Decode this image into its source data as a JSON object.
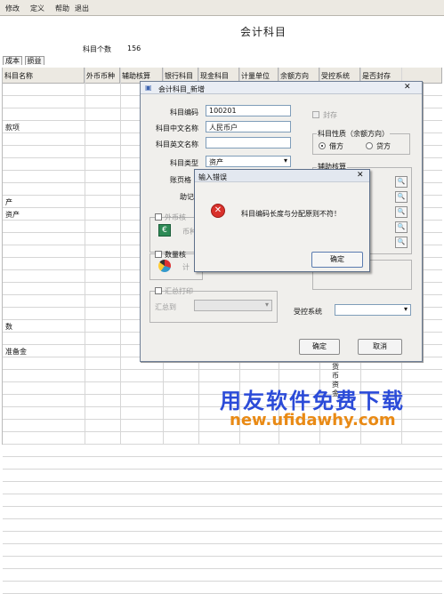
{
  "menu": [
    "修改",
    "定义",
    "帮助",
    "退出"
  ],
  "main": {
    "title": "会计科目",
    "count_label": "科目个数",
    "count_value": "156",
    "tabs": [
      "成本",
      "损益"
    ],
    "headers": [
      "科目名称",
      "外币币种",
      "辅助核算",
      "银行科目",
      "现金科目",
      "计量单位",
      "余额方向",
      "受控系统",
      "是否封存"
    ],
    "rows": [
      "",
      "",
      "",
      "款项",
      "",
      "",
      "",
      "",
      "",
      "产",
      "资产",
      "",
      "",
      "",
      "",
      "",
      "",
      "",
      "",
      "数",
      "",
      "准备金",
      "",
      "",
      "",
      "",
      "",
      "",
      "",
      "",
      "",
      "",
      "",
      "",
      "",
      "",
      "",
      "",
      "",
      "",
      ""
    ],
    "vertical_text": "货币资金"
  },
  "dialog": {
    "title": "会计科目_新增",
    "code_label": "科目编码",
    "code_value": "100201",
    "cn_name_label": "科目中文名称",
    "cn_name_value": "人民币户",
    "en_name_label": "科目英文名称",
    "en_name_value": "",
    "type_label": "科目类型",
    "type_value": "资产",
    "format_label": "账页格",
    "assist_label": "助记",
    "fc_label": "外币核",
    "fc_currency": "币种",
    "qty_label": "数量核",
    "qty_unit": "计",
    "sum_label": "汇总打印",
    "sum_to": "汇总到",
    "sealed_label": "封存",
    "nature_label": "科目性质（余额方向）",
    "debit": "借方",
    "credit": "贷方",
    "assist_group": "辅助核算",
    "control_label": "受控系统",
    "ok": "确定",
    "cancel": "取消"
  },
  "error": {
    "title": "输入错误",
    "message": "科目编码长度与分配原则不符！",
    "ok": "确定"
  },
  "watermark": {
    "line1": "用友软件免费下载",
    "line2": "new.ufidawhy.com"
  },
  "colors": {
    "error_icon": "#d9312b",
    "watermark_blue": "#2b4bd8",
    "watermark_orange": "#e98a15"
  }
}
